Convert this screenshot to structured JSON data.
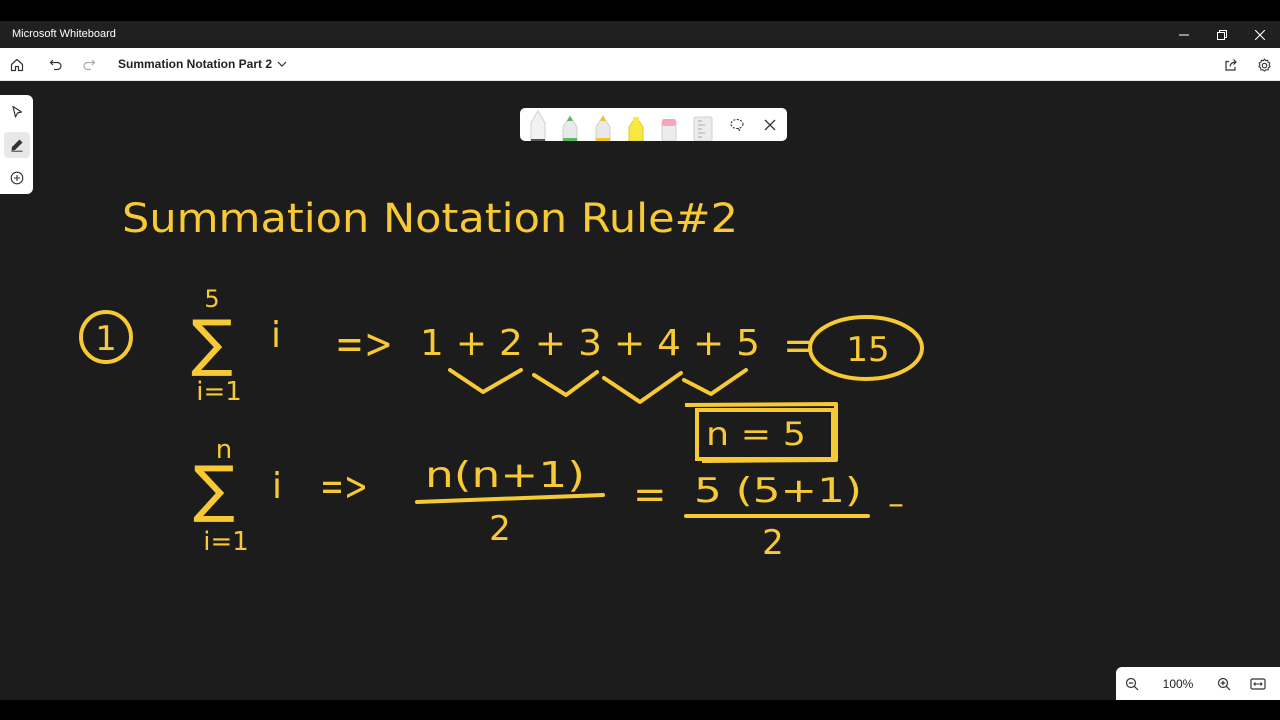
{
  "window": {
    "app_title": "Microsoft Whiteboard",
    "icons": {
      "minimize": "minimize-icon",
      "restore": "restore-icon",
      "close": "close-icon"
    }
  },
  "toolbar": {
    "document_title": "Summation Notation Part 2",
    "icons": {
      "home": "home-icon",
      "undo": "undo-icon",
      "redo": "redo-icon",
      "share": "share-icon",
      "settings": "gear-icon"
    }
  },
  "left_tools": [
    "select-arrow-icon",
    "pen-icon",
    "add-icon"
  ],
  "pen_tray": {
    "pens": [
      "white-pen",
      "green-pen",
      "yellow-pen",
      "yellow-highlighter",
      "eraser",
      "ruler"
    ],
    "icons": {
      "lasso": "lasso-icon",
      "close": "close-icon"
    }
  },
  "zoom": {
    "level": "100%",
    "icons": {
      "zoom_out": "zoom-out-icon",
      "zoom_in": "zoom-in-icon",
      "fit": "fit-to-screen-icon"
    }
  },
  "ink_color": "#F7C934",
  "colors": {
    "titlebar_bg": "#202020",
    "canvas_bg": "#1c1c1c",
    "toolbar_bg": "#ffffff"
  },
  "whiteboard": {
    "heading": "Summation Notation Rule#2",
    "example_number": "1",
    "line1": {
      "sum_upper": "5",
      "sum_symbol": "∑",
      "sum_lower": "i=1",
      "term": "i",
      "arrow": "=>",
      "expansion": "1 + 2 + 3 + 4 + 5",
      "equals": "=",
      "result": "15"
    },
    "boxed_note": "n = 5",
    "line2": {
      "sum_upper": "n",
      "sum_symbol": "∑",
      "sum_lower": "i=1",
      "term": "i",
      "arrow": "=>",
      "formula_numerator": "n(n+1)",
      "formula_denominator": "2",
      "equals": "=",
      "sub_numerator": "5 (5+1)",
      "sub_denominator": "2",
      "trailing": "–"
    }
  }
}
